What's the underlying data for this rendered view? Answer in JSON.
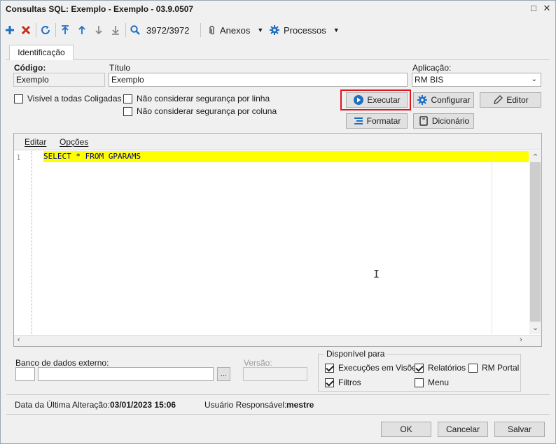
{
  "window": {
    "title": "Consultas SQL: Exemplo - Exemplo  - 03.9.0507",
    "restore_glyph": "□",
    "close_glyph": "✕"
  },
  "toolbar": {
    "record_counter": "3972/3972",
    "attachments_label": "Anexos",
    "processes_label": "Processos",
    "icons": [
      "add-icon",
      "delete-icon",
      "refresh-icon",
      "first-icon",
      "previous-icon",
      "next-icon",
      "last-icon",
      "search-icon",
      "paperclip-icon",
      "gear-icon"
    ]
  },
  "tabs": [
    {
      "label": "Identificação",
      "active": true
    }
  ],
  "form": {
    "code_label": "Código:",
    "code_value": "Exemplo",
    "title_label": "Título",
    "title_value": "Exemplo",
    "application_label": "Aplicação:",
    "application_value": "RM BIS",
    "visible_all_label": "Visível a todas Coligadas",
    "ignore_row_security_label": "Não considerar segurança por linha",
    "ignore_column_security_label": "Não considerar segurança por coluna"
  },
  "actions": {
    "execute": "Executar",
    "configure": "Configurar",
    "editor": "Editor",
    "format": "Formatar",
    "dictionary": "Dicionário"
  },
  "editor": {
    "menu_edit": "Editar",
    "menu_options": "Opções",
    "line_number": "1",
    "sql": "SELECT * FROM GPARAMS"
  },
  "external_db": {
    "label": "Banco de dados externo:",
    "browse_label": "...",
    "version_label": "Versão:"
  },
  "available_for": {
    "title": "Disponível para",
    "options": [
      {
        "label": "Execuções em Visões",
        "checked": true
      },
      {
        "label": "Relatórios",
        "checked": true
      },
      {
        "label": "RM Portal",
        "checked": false
      },
      {
        "label": "Filtros",
        "checked": true
      },
      {
        "label": "Menu",
        "checked": false
      }
    ]
  },
  "footer": {
    "last_change_label": "Data da Última Alteração:",
    "last_change_value": "03/01/2023 15:06",
    "user_label": "Usuário Responsável:",
    "user_value": "mestre"
  },
  "buttons": {
    "ok": "OK",
    "cancel": "Cancelar",
    "save": "Salvar"
  },
  "colors": {
    "accent_blue": "#1f6fbf",
    "delete_red": "#c42b1c",
    "highlight_yellow": "#ffff00",
    "highlight_border": "#e0141e",
    "sql_keyword": "#00008b"
  }
}
